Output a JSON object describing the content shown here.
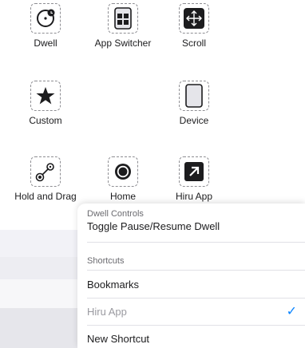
{
  "grid": {
    "dwell_label": "Dwell",
    "app_switcher_label": "App Switcher",
    "scroll_label": "Scroll",
    "custom_label": "Custom",
    "device_label": "Device",
    "hold_drag_label": "Hold and Drag",
    "home_label": "Home",
    "hiru_app_label": "Hiru App"
  },
  "sheet": {
    "dwell_controls_header": "Dwell Controls",
    "toggle_row": "Toggle Pause/Resume Dwell",
    "shortcuts_header": "Shortcuts",
    "bookmarks_row": "Bookmarks",
    "hiru_row": "Hiru App",
    "new_shortcut_row": "New Shortcut",
    "checkmark": "✓"
  },
  "colors": {
    "accent": "#0a84ff",
    "disabled_text": "#9a9aa0"
  }
}
